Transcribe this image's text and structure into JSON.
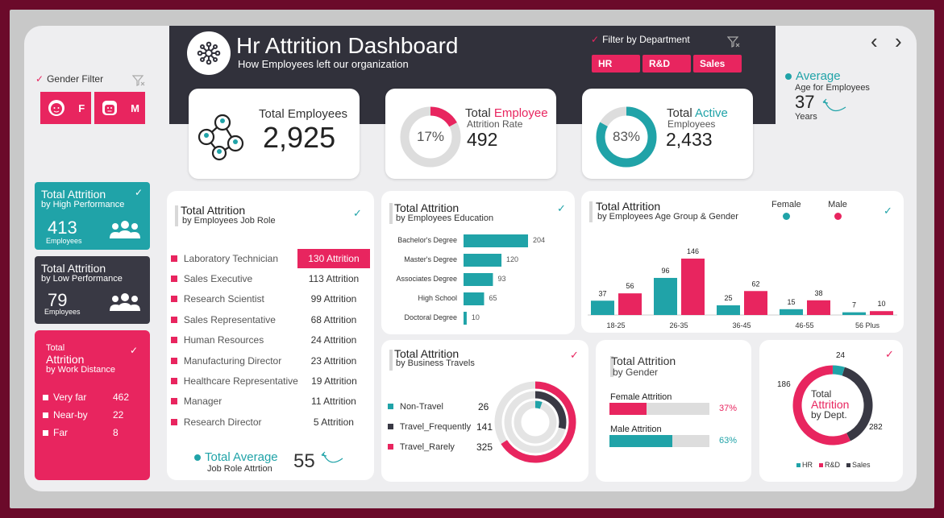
{
  "header": {
    "title": "Hr Attrition Dashboard",
    "subtitle": "How Employees left our organization",
    "dept_filter_label": "Filter by Department",
    "dept_buttons": [
      "HR",
      "R&D",
      "Sales"
    ]
  },
  "gender_filter": {
    "label": "Gender Filter",
    "female": "F",
    "male": "M"
  },
  "nav": {
    "prev": "‹",
    "next": "›"
  },
  "kpi": {
    "total_employees": {
      "label": "Total Employees",
      "value": "2,925"
    },
    "attrition_rate": {
      "label_1": "Total",
      "label_highlight": "Employee",
      "label_2": "Attrition Rate",
      "percent": "17%",
      "value": "492",
      "fraction": 0.17
    },
    "active": {
      "label_1": "Total",
      "label_highlight": "Active",
      "label_2": "Employees",
      "percent": "83%",
      "value": "2,433",
      "fraction": 0.83
    },
    "average_age": {
      "title": "Average",
      "subtitle": "Age for Employees",
      "value": "37",
      "unit": "Years"
    }
  },
  "side_cards": {
    "high_perf": {
      "title": "Total Attrition",
      "subtitle": "by High Performance",
      "value": "413",
      "unit": "Employees"
    },
    "low_perf": {
      "title": "Total Attrition",
      "subtitle": "by Low Performance",
      "value": "79",
      "unit": "Employees"
    },
    "distance": {
      "title_1": "Total",
      "title_2": "Attrition",
      "subtitle": "by Work Distance",
      "items": [
        {
          "label": "Very far",
          "value": "462"
        },
        {
          "label": "Near-by",
          "value": "22"
        },
        {
          "label": "Far",
          "value": "8"
        }
      ]
    }
  },
  "job_role": {
    "title": "Total Attrition",
    "subtitle": "by Employees Job Role",
    "rows": [
      {
        "role": "Laboratory Technician",
        "value": "130 Attrition"
      },
      {
        "role": "Sales Executive",
        "value": "113 Attrition"
      },
      {
        "role": "Research Scientist",
        "value": "99 Attrition"
      },
      {
        "role": "Sales Representative",
        "value": "68 Attrition"
      },
      {
        "role": "Human Resources",
        "value": "24 Attrition"
      },
      {
        "role": "Manufacturing Director",
        "value": "23 Attrition"
      },
      {
        "role": "Healthcare Representative",
        "value": "19 Attrition"
      },
      {
        "role": "Manager",
        "value": "11 Attrition"
      },
      {
        "role": "Research Director",
        "value": "5 Attrition"
      }
    ],
    "avg_title": "Total Average",
    "avg_subtitle": "Job Role Attrtion",
    "avg_value": "55"
  },
  "education": {
    "title": "Total Attrition",
    "subtitle": "by Employees Education",
    "categories": [
      "Bachelor's Degree",
      "Master's Degree",
      "Associates Degree",
      "High School",
      "Doctoral Degree"
    ],
    "values": [
      204,
      120,
      93,
      65,
      10
    ]
  },
  "age_gender": {
    "title": "Total Attrition",
    "subtitle": "by Employees Age Group & Gender",
    "legend": [
      "Female",
      "Male"
    ],
    "categories": [
      "18-25",
      "26-35",
      "36-45",
      "46-55",
      "56 Plus"
    ],
    "female": [
      37,
      96,
      25,
      15,
      7
    ],
    "male": [
      56,
      146,
      62,
      38,
      10
    ]
  },
  "travel": {
    "title": "Total Attrition",
    "subtitle": "by Business Travels",
    "rows": [
      {
        "label": "Non-Travel",
        "value": "26",
        "color": "#20a3a8"
      },
      {
        "label": "Travel_Frequently",
        "value": "141",
        "color": "#393944"
      },
      {
        "label": "Travel_Rarely",
        "value": "325",
        "color": "#e8255f"
      }
    ]
  },
  "gender": {
    "title": "Total Attrition",
    "subtitle": "by Gender",
    "female_label": "Female Attrition",
    "female_pct": "37%",
    "female_frac": 0.37,
    "male_label": "Male Attrition",
    "male_pct": "63%",
    "male_frac": 0.63
  },
  "dept": {
    "title_1": "Total",
    "title_2": "Attrition",
    "title_3": "by Dept.",
    "values": [
      24,
      186,
      282
    ],
    "labels": [
      "24",
      "186",
      "282"
    ],
    "legend": [
      "HR",
      "R&D",
      "Sales"
    ],
    "colors": [
      "#20a3a8",
      "#393944",
      "#e8255f"
    ]
  },
  "colors": {
    "pink": "#e8255f",
    "teal": "#20a3a8",
    "dark": "#393944"
  },
  "chart_data": [
    {
      "type": "bar",
      "title": "Total Attrition by Employees Education",
      "categories": [
        "Bachelor's Degree",
        "Master's Degree",
        "Associates Degree",
        "High School",
        "Doctoral Degree"
      ],
      "values": [
        204,
        120,
        93,
        65,
        10
      ]
    },
    {
      "type": "bar",
      "title": "Total Attrition by Employees Age Group & Gender",
      "categories": [
        "18-25",
        "26-35",
        "36-45",
        "46-55",
        "56 Plus"
      ],
      "series": [
        {
          "name": "Female",
          "values": [
            37,
            96,
            25,
            15,
            7
          ]
        },
        {
          "name": "Male",
          "values": [
            56,
            146,
            62,
            38,
            10
          ]
        }
      ]
    },
    {
      "type": "pie",
      "title": "Total Attrition by Dept.",
      "categories": [
        "HR",
        "R&D",
        "Sales"
      ],
      "values": [
        24,
        186,
        282
      ]
    },
    {
      "type": "pie",
      "title": "Total Attrition by Business Travels",
      "categories": [
        "Non-Travel",
        "Travel_Frequently",
        "Travel_Rarely"
      ],
      "values": [
        26,
        141,
        325
      ]
    }
  ]
}
